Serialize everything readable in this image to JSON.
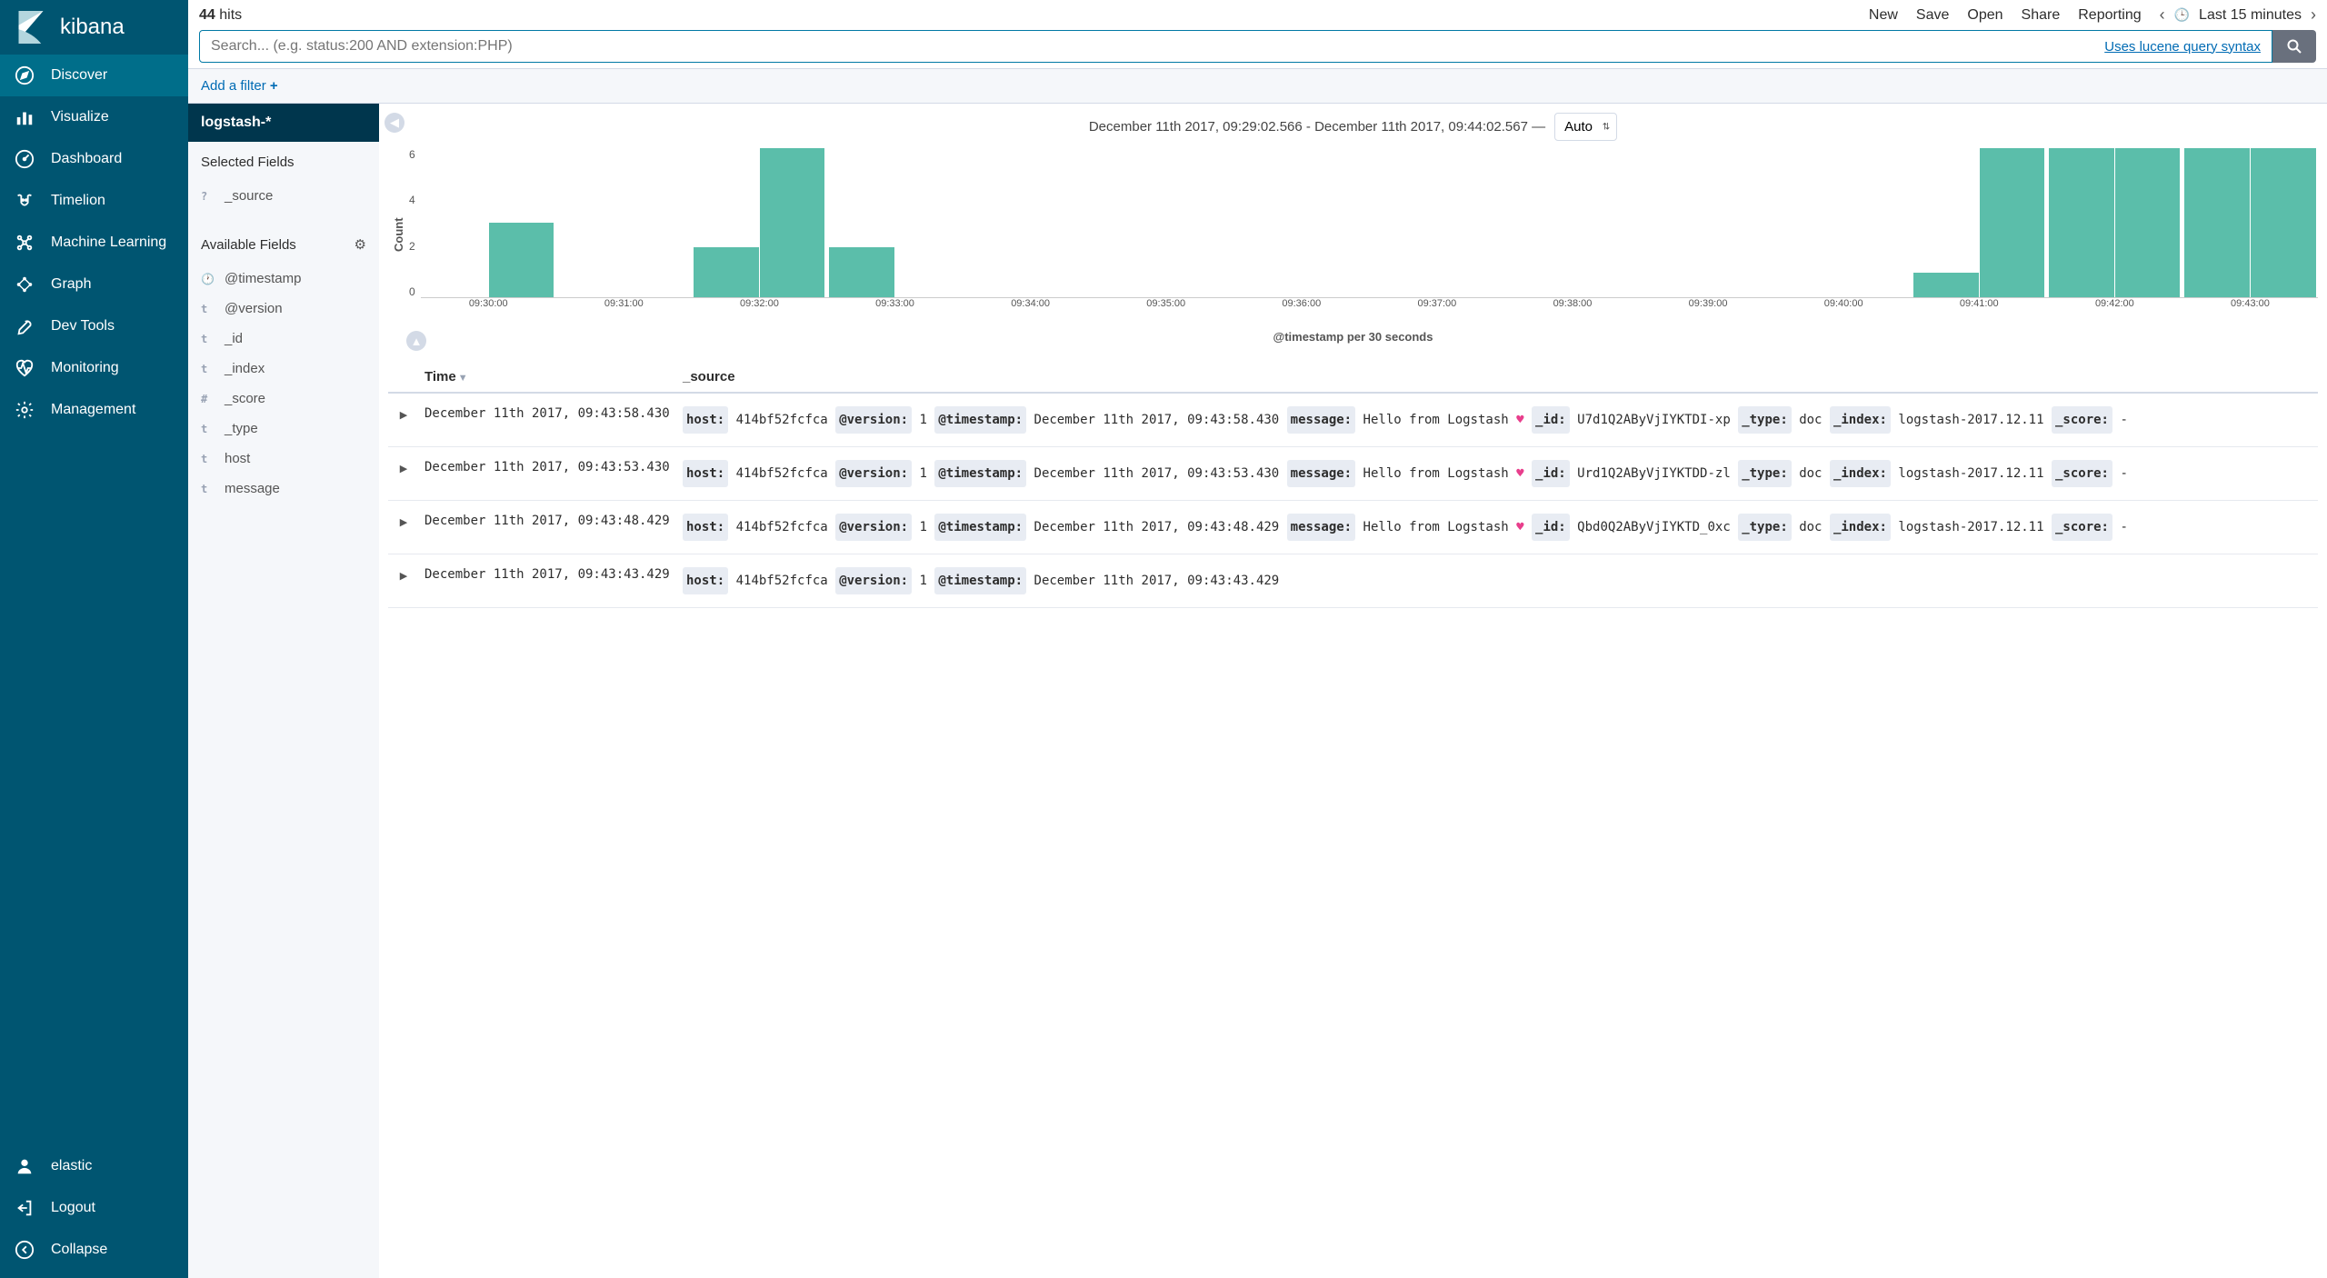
{
  "brand": "kibana",
  "nav": {
    "items": [
      {
        "id": "discover",
        "label": "Discover",
        "active": true
      },
      {
        "id": "visualize",
        "label": "Visualize"
      },
      {
        "id": "dashboard",
        "label": "Dashboard"
      },
      {
        "id": "timelion",
        "label": "Timelion"
      },
      {
        "id": "ml",
        "label": "Machine Learning"
      },
      {
        "id": "graph",
        "label": "Graph"
      },
      {
        "id": "devtools",
        "label": "Dev Tools"
      },
      {
        "id": "monitoring",
        "label": "Monitoring"
      },
      {
        "id": "management",
        "label": "Management"
      }
    ],
    "footer": [
      {
        "id": "user",
        "label": "elastic"
      },
      {
        "id": "logout",
        "label": "Logout"
      },
      {
        "id": "collapse",
        "label": "Collapse"
      }
    ]
  },
  "hits": {
    "count": "44",
    "label": "hits"
  },
  "toolbar": [
    "New",
    "Save",
    "Open",
    "Share",
    "Reporting"
  ],
  "time_range": "Last 15 minutes",
  "search": {
    "placeholder": "Search... (e.g. status:200 AND extension:PHP)",
    "syntax_link": "Uses lucene query syntax"
  },
  "filter": {
    "add_label": "Add a filter"
  },
  "index_pattern": "logstash-*",
  "fields": {
    "selected_header": "Selected Fields",
    "selected": [
      {
        "type": "?",
        "name": "_source"
      }
    ],
    "available_header": "Available Fields",
    "available": [
      {
        "type": "🕐",
        "name": "@timestamp"
      },
      {
        "type": "t",
        "name": "@version"
      },
      {
        "type": "t",
        "name": "_id"
      },
      {
        "type": "t",
        "name": "_index"
      },
      {
        "type": "#",
        "name": "_score"
      },
      {
        "type": "t",
        "name": "_type"
      },
      {
        "type": "t",
        "name": "host"
      },
      {
        "type": "t",
        "name": "message"
      }
    ]
  },
  "chart_header": {
    "range": "December 11th 2017, 09:29:02.566 - December 11th 2017, 09:44:02.567 —",
    "interval": "Auto"
  },
  "chart_data": {
    "type": "bar",
    "ylabel": "Count",
    "xlabel": "@timestamp per 30 seconds",
    "ymax": 6,
    "yticks": [
      6,
      4,
      2,
      0
    ],
    "slots": [
      {
        "label": "09:30:00",
        "bars": [
          0,
          3
        ]
      },
      {
        "label": "09:31:00",
        "bars": [
          0,
          0
        ]
      },
      {
        "label": "09:32:00",
        "bars": [
          2,
          6
        ]
      },
      {
        "label": "09:33:00",
        "bars": [
          2,
          0
        ]
      },
      {
        "label": "09:34:00",
        "bars": [
          0,
          0
        ]
      },
      {
        "label": "09:35:00",
        "bars": [
          0,
          0
        ]
      },
      {
        "label": "09:36:00",
        "bars": [
          0,
          0
        ]
      },
      {
        "label": "09:37:00",
        "bars": [
          0,
          0
        ]
      },
      {
        "label": "09:38:00",
        "bars": [
          0,
          0
        ]
      },
      {
        "label": "09:39:00",
        "bars": [
          0,
          0
        ]
      },
      {
        "label": "09:40:00",
        "bars": [
          0,
          0
        ]
      },
      {
        "label": "09:41:00",
        "bars": [
          1,
          6
        ]
      },
      {
        "label": "09:42:00",
        "bars": [
          6,
          6
        ]
      },
      {
        "label": "09:43:00",
        "bars": [
          6,
          6
        ]
      }
    ]
  },
  "table": {
    "columns": {
      "time": "Time",
      "source": "_source"
    },
    "rows": [
      {
        "time": "December 11th 2017, 09:43:58.430",
        "fields": {
          "host": "414bf52fcfca",
          "@version": "1",
          "@timestamp": "December 11th 2017, 09:43:58.430",
          "message": "Hello from Logstash",
          "_id": "U7d1Q2AByVjIYKTDI-xp",
          "_type": "doc",
          "_index": "logstash-2017.12.11",
          "_score": "-"
        }
      },
      {
        "time": "December 11th 2017, 09:43:53.430",
        "fields": {
          "host": "414bf52fcfca",
          "@version": "1",
          "@timestamp": "December 11th 2017, 09:43:53.430",
          "message": "Hello from Logstash",
          "_id": "Urd1Q2AByVjIYKTDD-zl",
          "_type": "doc",
          "_index": "logstash-2017.12.11",
          "_score": "-"
        }
      },
      {
        "time": "December 11th 2017, 09:43:48.429",
        "fields": {
          "host": "414bf52fcfca",
          "@version": "1",
          "@timestamp": "December 11th 2017, 09:43:48.429",
          "message": "Hello from Logstash",
          "_id": "Qbd0Q2AByVjIYKTD_0xc",
          "_type": "doc",
          "_index": "logstash-2017.12.11",
          "_score": "-"
        }
      },
      {
        "time": "December 11th 2017, 09:43:43.429",
        "fields": {
          "host": "414bf52fcfca",
          "@version": "1",
          "@timestamp": "December 11th 2017, 09:43:43.429"
        }
      }
    ]
  }
}
